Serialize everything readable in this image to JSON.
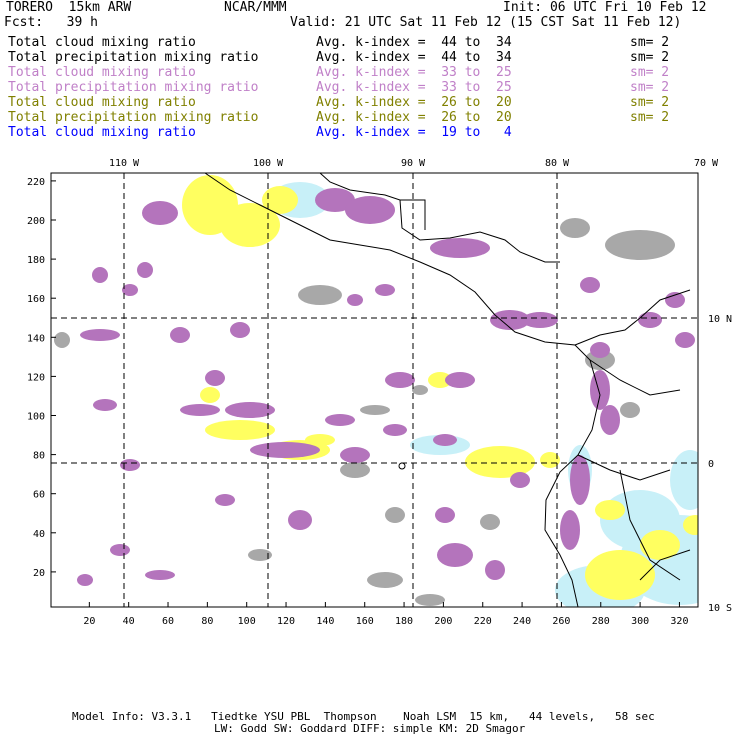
{
  "header": {
    "model": "TORERO  15km ARW",
    "org": "NCAR/MMM",
    "init": "Init: 06 UTC Fri 10 Feb 12",
    "fcst": "Fcst:   39 h",
    "valid": "Valid: 21 UTC Sat 11 Feb 12 (15 CST Sat 11 Feb 12)"
  },
  "legend": [
    {
      "field": "Total cloud mixing ratio",
      "kindex": "Avg. k-index =  44 to  34",
      "sm": "sm= 2",
      "color": "#000000"
    },
    {
      "field": "Total precipitation mixing ratio",
      "kindex": "Avg. k-index =  44 to  34",
      "sm": "sm= 2",
      "color": "#000000"
    },
    {
      "field": "Total cloud mixing ratio",
      "kindex": "Avg. k-index =  33 to  25",
      "sm": "sm= 2",
      "color": "#c080c8"
    },
    {
      "field": "Total precipitation mixing ratio",
      "kindex": "Avg. k-index =  33 to  25",
      "sm": "sm= 2",
      "color": "#c080c8"
    },
    {
      "field": "Total cloud mixing ratio",
      "kindex": "Avg. k-index =  26 to  20",
      "sm": "sm= 2",
      "color": "#808000"
    },
    {
      "field": "Total precipitation mixing ratio",
      "kindex": "Avg. k-index =  26 to  20",
      "sm": "sm= 2",
      "color": "#808000"
    },
    {
      "field": "Total cloud mixing ratio",
      "kindex": "Avg. k-index =  19 to   4",
      "sm": "",
      "color": "#0000ff"
    }
  ],
  "map": {
    "lon_labels": [
      "110 W",
      "100 W",
      "90 W",
      "80 W",
      "70 W"
    ],
    "lat_labels": [
      "10 N",
      "0",
      "10 S"
    ],
    "x_ticks": [
      "20",
      "40",
      "60",
      "80",
      "100",
      "120",
      "140",
      "160",
      "180",
      "200",
      "220",
      "240",
      "260",
      "280",
      "300",
      "320"
    ],
    "y_ticks": [
      "20",
      "40",
      "60",
      "80",
      "100",
      "120",
      "140",
      "160",
      "180",
      "200",
      "220"
    ],
    "colors": {
      "gray": "#a8a8a8",
      "purple": "#b474bc",
      "yellow": "#ffff60",
      "cyan": "#c8f0f8"
    }
  },
  "footer": {
    "line1": "Model Info: V3.3.1   Tiedtke YSU PBL  Thompson    Noah LSM  15 km,   44 levels,   58 sec",
    "line2": "LW: Godd SW: Goddard DIFF: simple KM: 2D Smagor"
  }
}
